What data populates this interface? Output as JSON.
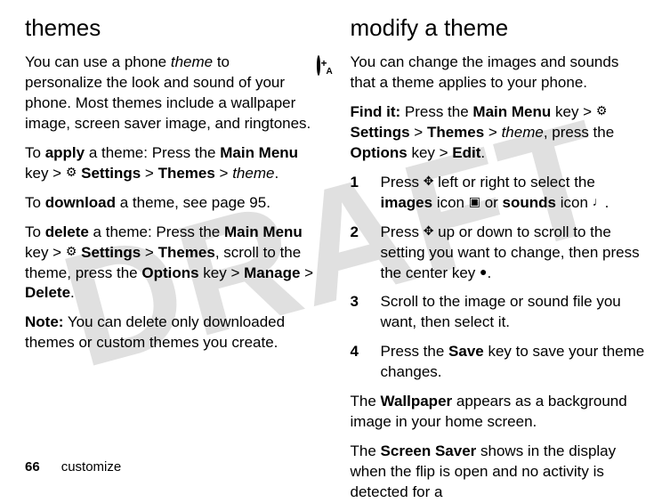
{
  "watermark": "DRAFT",
  "left": {
    "heading": "themes",
    "p1_a": "You can use a phone ",
    "p1_theme": "theme",
    "p1_b": " to personalize the look and sound of your phone. Most themes include a wallpaper image, screen saver image, and ringtones.",
    "p2_a": "To ",
    "p2_apply": "apply",
    "p2_b": " a theme: Press the ",
    "p2_mm": "Main Menu",
    "p2_c": " key > ",
    "p2_settings": "Settings",
    "p2_d": " > ",
    "p2_themes": "Themes",
    "p2_e": " > ",
    "p2_theme": "theme",
    "p2_f": ".",
    "p3_a": "To ",
    "p3_dl": "download",
    "p3_b": " a theme, see page 95.",
    "p4_a": "To ",
    "p4_del": "delete",
    "p4_b": " a theme: Press the ",
    "p4_mm": "Main Menu",
    "p4_c": " key > ",
    "p4_settings": "Settings",
    "p4_d": " > ",
    "p4_themes": "Themes",
    "p4_e": ", scroll to the theme, press the ",
    "p4_opt": "Options",
    "p4_f": " key > ",
    "p4_manage": "Manage",
    "p4_g": " > ",
    "p4_delete": "Delete",
    "p4_h": ".",
    "p5_a": "Note:",
    "p5_b": " You can delete only downloaded themes or custom themes you create."
  },
  "right": {
    "heading": "modify a theme",
    "p1": "You can change the images and sounds that a theme applies to your phone.",
    "fi_a": "Find it:",
    "fi_b": " Press the ",
    "fi_mm": "Main Menu",
    "fi_c": " key > ",
    "fi_settings": "Settings",
    "fi_d": " > ",
    "fi_themes": "Themes",
    "fi_e": " > ",
    "fi_theme": "theme",
    "fi_f": ", press the ",
    "fi_opt": "Options",
    "fi_g": " key > ",
    "fi_edit": "Edit",
    "fi_h": ".",
    "s1n": "1",
    "s1_a": "Press ",
    "s1_b": " left or right to select the ",
    "s1_images": "images",
    "s1_c": " icon ",
    "s1_d": " or ",
    "s1_sounds": "sounds",
    "s1_e": " icon ",
    "s1_f": ".",
    "s2n": "2",
    "s2_a": "Press ",
    "s2_b": " up or down to scroll to the setting you want to change, then press the center key ",
    "s2_c": ".",
    "s3n": "3",
    "s3": "Scroll to the image or sound file you want, then select it.",
    "s4n": "4",
    "s4_a": "Press the ",
    "s4_save": "Save",
    "s4_b": " key to save your theme changes.",
    "p_wall_a": "The ",
    "p_wall_b": "Wallpaper",
    "p_wall_c": " appears as a background image in your home screen.",
    "p_ss_a": "The ",
    "p_ss_b": "Screen Saver",
    "p_ss_c": " shows in the display when the flip is open and no activity is detected for a"
  },
  "footer": {
    "page": "66",
    "section": "customize"
  },
  "glyphs": {
    "settings": "⚙",
    "nav": "✥",
    "image": "▣",
    "sound": "♩",
    "center": "●"
  }
}
